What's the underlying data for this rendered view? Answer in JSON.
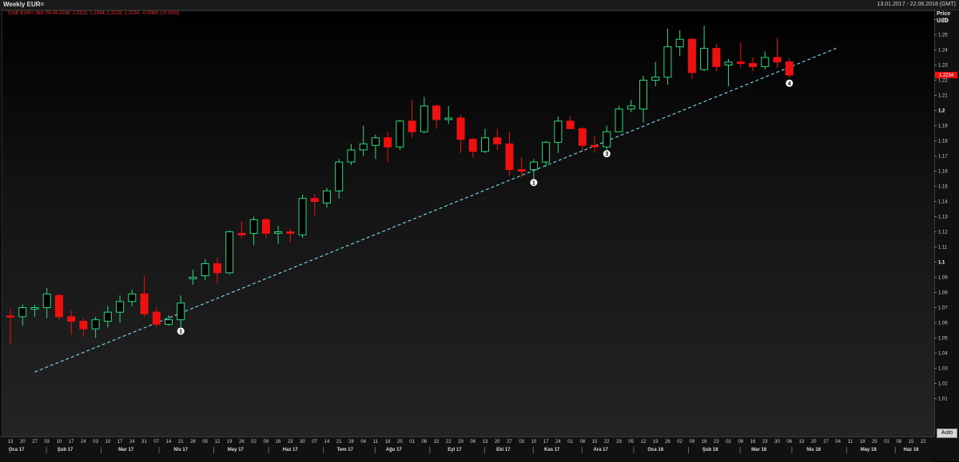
{
  "window": {
    "title": "Weekly EUR=",
    "date_range": "13.01.2017 - 22.06.2018 (GMT)",
    "info_line": "Cndl; EUR=; Bid; 06.04.2018; 1.2321; 1.2344; 1.2218; 1.2234; -0.0084; (-0.03%)",
    "auto_label": "Auto"
  },
  "yaxis": {
    "label1": "Price",
    "label2": "USD"
  },
  "colors": {
    "up": "#2bd97a",
    "down": "#ee1111",
    "trendline": "#7fe3ff",
    "marker": "#ffffff",
    "price_tag": "#ee1111"
  },
  "chart_data": {
    "type": "candlestick",
    "instrument": "EUR=",
    "ylim": [
      1.0,
      1.265
    ],
    "yticks": [
      1.01,
      1.02,
      1.03,
      1.04,
      1.05,
      1.06,
      1.07,
      1.08,
      1.09,
      1.1,
      1.11,
      1.12,
      1.13,
      1.14,
      1.15,
      1.16,
      1.17,
      1.18,
      1.19,
      1.2,
      1.21,
      1.22,
      1.23,
      1.24,
      1.25,
      1.26
    ],
    "ytick_labels": [
      "1.01",
      "1.02",
      "1.03",
      "1.04",
      "1.05",
      "1.06",
      "1.07",
      "1.08",
      "1.09",
      "1.1",
      "1.11",
      "1.12",
      "1.13",
      "1.14",
      "1.15",
      "1.16",
      "1.17",
      "1.18",
      "1.19",
      "1.2",
      "1.21",
      "1.22",
      "1.23",
      "1.24",
      "1.25",
      "1.26"
    ],
    "xticks": [
      "13",
      "20",
      "27",
      "03",
      "10",
      "17",
      "24",
      "03",
      "10",
      "17",
      "24",
      "31",
      "07",
      "14",
      "21",
      "28",
      "05",
      "12",
      "19",
      "26",
      "02",
      "09",
      "16",
      "23",
      "30",
      "07",
      "14",
      "21",
      "28",
      "04",
      "11",
      "18",
      "25",
      "01",
      "08",
      "15",
      "22",
      "29",
      "06",
      "13",
      "20",
      "27",
      "03",
      "10",
      "17",
      "24",
      "01",
      "08",
      "15",
      "22",
      "29",
      "05",
      "12",
      "19",
      "26",
      "02",
      "09",
      "16",
      "23",
      "02",
      "09",
      "16",
      "23",
      "30",
      "06",
      "13",
      "20",
      "27",
      "04",
      "11",
      "18",
      "25",
      "01",
      "08",
      "15",
      "22"
    ],
    "months": [
      {
        "label": "Oca 17",
        "at": 0.5
      },
      {
        "label": "Şub 17",
        "at": 4.5
      },
      {
        "label": "Mar 17",
        "at": 9.5
      },
      {
        "label": "Nis 17",
        "at": 14
      },
      {
        "label": "May 17",
        "at": 18.5
      },
      {
        "label": "Haz 17",
        "at": 23
      },
      {
        "label": "Tem 17",
        "at": 27.5
      },
      {
        "label": "Ağu 17",
        "at": 31.5
      },
      {
        "label": "Eyl 17",
        "at": 36.5
      },
      {
        "label": "Eki 17",
        "at": 40.5
      },
      {
        "label": "Kas 17",
        "at": 44.5
      },
      {
        "label": "Ara 17",
        "at": 48.5
      },
      {
        "label": "Oca 18",
        "at": 53
      },
      {
        "label": "Şub 18",
        "at": 57.5
      },
      {
        "label": "Mar 18",
        "at": 61.5
      },
      {
        "label": "Nis 18",
        "at": 66
      },
      {
        "label": "May 18",
        "at": 70.5
      },
      {
        "label": "Haz 18",
        "at": 74
      }
    ],
    "candles": [
      {
        "d": "13.01.2017",
        "o": 1.0645,
        "h": 1.0695,
        "l": 1.0455,
        "c": 1.064
      },
      {
        "d": "20.01.2017",
        "o": 1.064,
        "h": 1.072,
        "l": 1.058,
        "c": 1.07
      },
      {
        "d": "27.01.2017",
        "o": 1.069,
        "h": 1.072,
        "l": 1.064,
        "c": 1.07
      },
      {
        "d": "03.02.2017",
        "o": 1.07,
        "h": 1.083,
        "l": 1.063,
        "c": 1.079
      },
      {
        "d": "10.02.2017",
        "o": 1.078,
        "h": 1.079,
        "l": 1.062,
        "c": 1.064
      },
      {
        "d": "17.02.2017",
        "o": 1.064,
        "h": 1.068,
        "l": 1.052,
        "c": 1.061
      },
      {
        "d": "24.02.2017",
        "o": 1.061,
        "h": 1.063,
        "l": 1.051,
        "c": 1.056
      },
      {
        "d": "03.03.2017",
        "o": 1.056,
        "h": 1.064,
        "l": 1.05,
        "c": 1.062
      },
      {
        "d": "10.03.2017",
        "o": 1.061,
        "h": 1.071,
        "l": 1.057,
        "c": 1.067
      },
      {
        "d": "17.03.2017",
        "o": 1.067,
        "h": 1.078,
        "l": 1.06,
        "c": 1.074
      },
      {
        "d": "24.03.2017",
        "o": 1.074,
        "h": 1.082,
        "l": 1.071,
        "c": 1.079
      },
      {
        "d": "31.03.2017",
        "o": 1.079,
        "h": 1.091,
        "l": 1.064,
        "c": 1.066
      },
      {
        "d": "07.04.2017",
        "o": 1.067,
        "h": 1.07,
        "l": 1.057,
        "c": 1.059
      },
      {
        "d": "14.04.2017",
        "o": 1.059,
        "h": 1.065,
        "l": 1.058,
        "c": 1.062
      },
      {
        "d": "21.04.2017",
        "o": 1.062,
        "h": 1.078,
        "l": 1.057,
        "c": 1.073
      },
      {
        "d": "28.04.2017",
        "o": 1.089,
        "h": 1.095,
        "l": 1.085,
        "c": 1.09
      },
      {
        "d": "05.05.2017",
        "o": 1.091,
        "h": 1.102,
        "l": 1.088,
        "c": 1.099
      },
      {
        "d": "12.05.2017",
        "o": 1.099,
        "h": 1.103,
        "l": 1.086,
        "c": 1.093
      },
      {
        "d": "19.05.2017",
        "o": 1.093,
        "h": 1.121,
        "l": 1.092,
        "c": 1.12
      },
      {
        "d": "26.05.2017",
        "o": 1.119,
        "h": 1.127,
        "l": 1.116,
        "c": 1.118
      },
      {
        "d": "02.06.2017",
        "o": 1.119,
        "h": 1.13,
        "l": 1.111,
        "c": 1.128
      },
      {
        "d": "09.06.2017",
        "o": 1.128,
        "h": 1.129,
        "l": 1.116,
        "c": 1.119
      },
      {
        "d": "16.06.2017",
        "o": 1.119,
        "h": 1.124,
        "l": 1.112,
        "c": 1.12
      },
      {
        "d": "23.06.2017",
        "o": 1.12,
        "h": 1.122,
        "l": 1.113,
        "c": 1.119
      },
      {
        "d": "30.06.2017",
        "o": 1.118,
        "h": 1.1445,
        "l": 1.116,
        "c": 1.142
      },
      {
        "d": "07.07.2017",
        "o": 1.142,
        "h": 1.145,
        "l": 1.131,
        "c": 1.14
      },
      {
        "d": "14.07.2017",
        "o": 1.139,
        "h": 1.149,
        "l": 1.136,
        "c": 1.147
      },
      {
        "d": "21.07.2017",
        "o": 1.147,
        "h": 1.168,
        "l": 1.142,
        "c": 1.166
      },
      {
        "d": "28.07.2017",
        "o": 1.166,
        "h": 1.178,
        "l": 1.164,
        "c": 1.174
      },
      {
        "d": "04.08.2017",
        "o": 1.174,
        "h": 1.19,
        "l": 1.17,
        "c": 1.178
      },
      {
        "d": "11.08.2017",
        "o": 1.177,
        "h": 1.184,
        "l": 1.168,
        "c": 1.182
      },
      {
        "d": "18.08.2017",
        "o": 1.182,
        "h": 1.186,
        "l": 1.166,
        "c": 1.176
      },
      {
        "d": "25.08.2017",
        "o": 1.176,
        "h": 1.194,
        "l": 1.174,
        "c": 1.193
      },
      {
        "d": "01.09.2017",
        "o": 1.193,
        "h": 1.207,
        "l": 1.182,
        "c": 1.186
      },
      {
        "d": "08.09.2017",
        "o": 1.186,
        "h": 1.209,
        "l": 1.185,
        "c": 1.203
      },
      {
        "d": "15.09.2017",
        "o": 1.203,
        "h": 1.204,
        "l": 1.188,
        "c": 1.194
      },
      {
        "d": "22.09.2017",
        "o": 1.194,
        "h": 1.203,
        "l": 1.191,
        "c": 1.195
      },
      {
        "d": "29.09.2017",
        "o": 1.195,
        "h": 1.197,
        "l": 1.172,
        "c": 1.181
      },
      {
        "d": "06.10.2017",
        "o": 1.181,
        "h": 1.182,
        "l": 1.169,
        "c": 1.173
      },
      {
        "d": "13.10.2017",
        "o": 1.173,
        "h": 1.188,
        "l": 1.172,
        "c": 1.182
      },
      {
        "d": "20.10.2017",
        "o": 1.182,
        "h": 1.188,
        "l": 1.174,
        "c": 1.178
      },
      {
        "d": "27.10.2017",
        "o": 1.178,
        "h": 1.186,
        "l": 1.157,
        "c": 1.161
      },
      {
        "d": "03.11.2017",
        "o": 1.161,
        "h": 1.169,
        "l": 1.156,
        "c": 1.16
      },
      {
        "d": "10.11.2017",
        "o": 1.161,
        "h": 1.168,
        "l": 1.155,
        "c": 1.166
      },
      {
        "d": "17.11.2017",
        "o": 1.166,
        "h": 1.18,
        "l": 1.163,
        "c": 1.179
      },
      {
        "d": "24.11.2017",
        "o": 1.179,
        "h": 1.196,
        "l": 1.172,
        "c": 1.193
      },
      {
        "d": "01.12.2017",
        "o": 1.193,
        "h": 1.196,
        "l": 1.188,
        "c": 1.188
      },
      {
        "d": "08.12.2017",
        "o": 1.188,
        "h": 1.189,
        "l": 1.173,
        "c": 1.177
      },
      {
        "d": "15.12.2017",
        "o": 1.177,
        "h": 1.183,
        "l": 1.172,
        "c": 1.176
      },
      {
        "d": "22.12.2017",
        "o": 1.176,
        "h": 1.19,
        "l": 1.174,
        "c": 1.186
      },
      {
        "d": "29.12.2017",
        "o": 1.186,
        "h": 1.203,
        "l": 1.186,
        "c": 1.201
      },
      {
        "d": "05.01.2018",
        "o": 1.201,
        "h": 1.207,
        "l": 1.199,
        "c": 1.203
      },
      {
        "d": "12.01.2018",
        "o": 1.201,
        "h": 1.223,
        "l": 1.192,
        "c": 1.22
      },
      {
        "d": "19.01.2018",
        "o": 1.22,
        "h": 1.232,
        "l": 1.216,
        "c": 1.222
      },
      {
        "d": "26.01.2018",
        "o": 1.222,
        "h": 1.254,
        "l": 1.217,
        "c": 1.242
      },
      {
        "d": "02.02.2018",
        "o": 1.242,
        "h": 1.253,
        "l": 1.236,
        "c": 1.247
      },
      {
        "d": "09.02.2018",
        "o": 1.247,
        "h": 1.248,
        "l": 1.221,
        "c": 1.225
      },
      {
        "d": "16.02.2018",
        "o": 1.227,
        "h": 1.256,
        "l": 1.226,
        "c": 1.241
      },
      {
        "d": "23.02.2018",
        "o": 1.241,
        "h": 1.244,
        "l": 1.226,
        "c": 1.229
      },
      {
        "d": "02.03.2018",
        "o": 1.23,
        "h": 1.234,
        "l": 1.216,
        "c": 1.232
      },
      {
        "d": "09.03.2018",
        "o": 1.232,
        "h": 1.245,
        "l": 1.228,
        "c": 1.231
      },
      {
        "d": "16.03.2018",
        "o": 1.231,
        "h": 1.235,
        "l": 1.226,
        "c": 1.229
      },
      {
        "d": "23.03.2018",
        "o": 1.229,
        "h": 1.239,
        "l": 1.227,
        "c": 1.235
      },
      {
        "d": "30.03.2018",
        "o": 1.235,
        "h": 1.248,
        "l": 1.228,
        "c": 1.232
      },
      {
        "d": "06.04.2018",
        "o": 1.2321,
        "h": 1.2344,
        "l": 1.2218,
        "c": 1.2234
      }
    ],
    "trendline": {
      "from": {
        "d": "27.01.2017",
        "y": 1.0275
      },
      "to": {
        "d": "04.05.2018",
        "y": 1.2415
      }
    },
    "markers": [
      {
        "label": "1",
        "d": "21.04.2017",
        "y": 1.0545
      },
      {
        "label": "1",
        "d": "10.11.2017",
        "y": 1.1525
      },
      {
        "label": "3",
        "d": "22.12.2017",
        "y": 1.1715
      },
      {
        "label": "4",
        "d": "06.04.2018",
        "y": 1.218
      }
    ],
    "last_price": {
      "value": 1.2234,
      "label": "1.2234"
    }
  }
}
